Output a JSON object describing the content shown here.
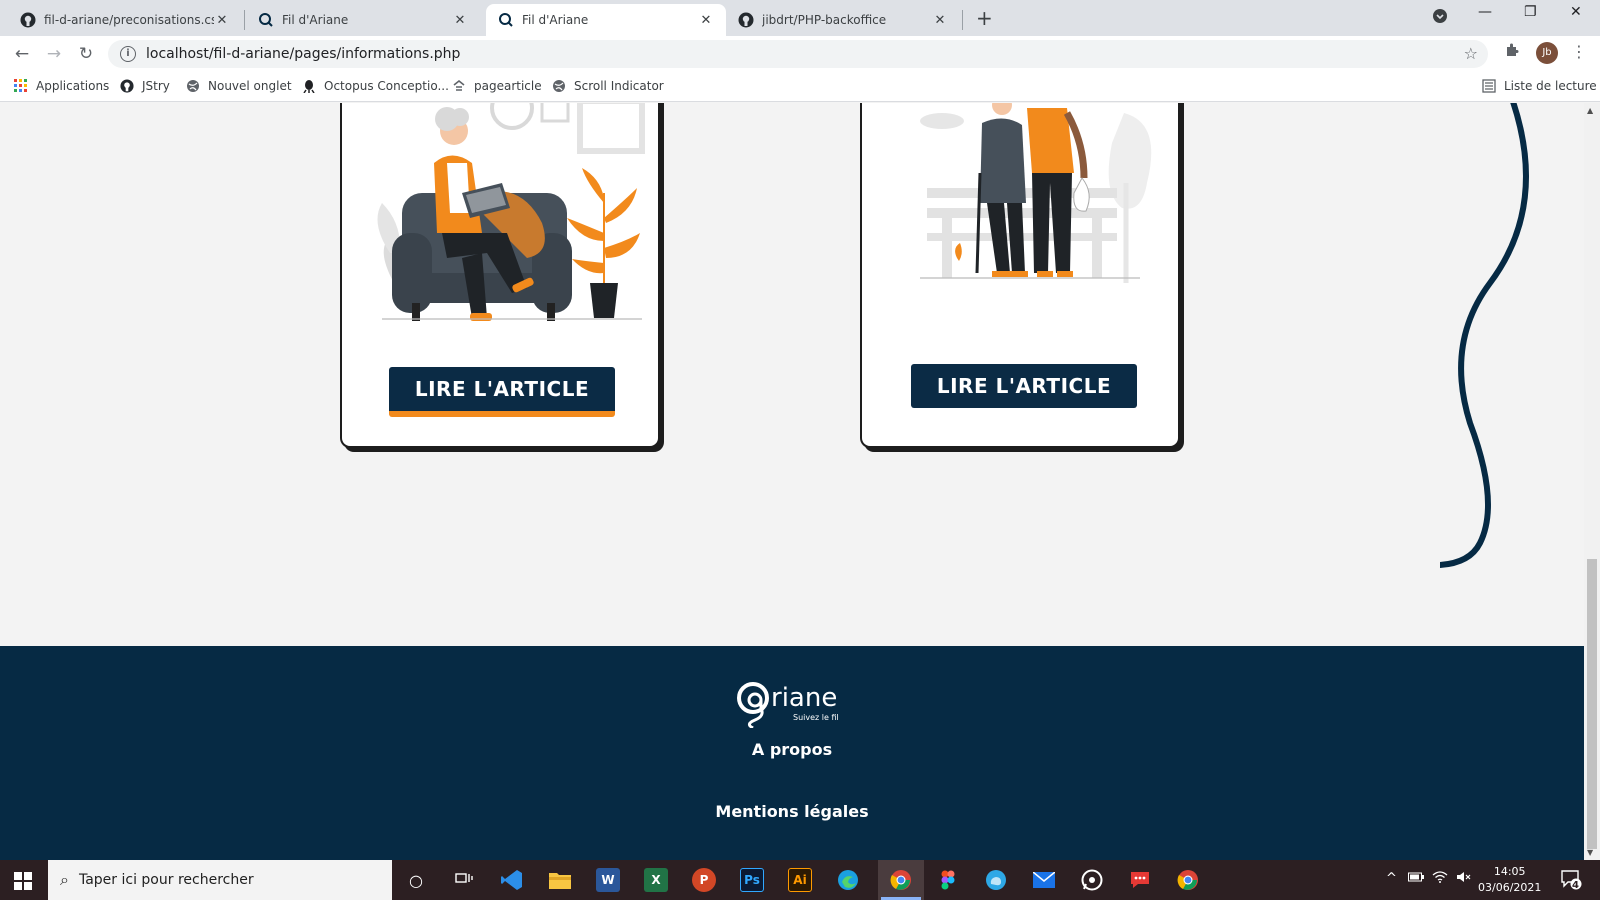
{
  "browser": {
    "tabs": [
      {
        "title": "fil-d-ariane/preconisations.css at",
        "icon": "github-icon"
      },
      {
        "title": "Fil d'Ariane",
        "icon": "ariane-icon"
      },
      {
        "title": "Fil d'Ariane",
        "icon": "ariane-icon",
        "active": true
      },
      {
        "title": "jibdrt/PHP-backoffice",
        "icon": "github-icon"
      }
    ],
    "url": "localhost/fil-d-ariane/pages/informations.php",
    "profile_initials": "Jb",
    "bookmarks": [
      {
        "label": "Applications",
        "icon": "apps-grid-icon"
      },
      {
        "label": "JStry",
        "icon": "github-icon"
      },
      {
        "label": "Nouvel onglet",
        "icon": "globe-icon"
      },
      {
        "label": "Octopus Conceptio...",
        "icon": "octopus-icon"
      },
      {
        "label": "pagearticle",
        "icon": "page-icon"
      },
      {
        "label": "Scroll Indicator",
        "icon": "globe-icon"
      }
    ],
    "reading_list": "Liste de lecture"
  },
  "page": {
    "cards": [
      {
        "button_label": "LIRE L'ARTICLE",
        "illustration": "woman-reading-armchair"
      },
      {
        "button_label": "LIRE L'ARTICLE",
        "illustration": "volunteer-helping-elder"
      }
    ],
    "footer": {
      "logo_word": "riane",
      "logo_tagline": "Suivez le fil",
      "links": [
        "A propos",
        "Mentions légales"
      ]
    },
    "colors": {
      "navy": "#062a44",
      "orange": "#f28a1c",
      "background": "#f3f3f3"
    }
  },
  "taskbar": {
    "search_placeholder": "Taper ici pour rechercher",
    "time": "14:05",
    "date": "03/06/2021",
    "notification_count": "4",
    "apps": [
      "task-view-icon",
      "vscode-icon",
      "file-explorer-icon",
      "word-icon",
      "excel-icon",
      "powerpoint-icon",
      "photoshop-icon",
      "illustrator-icon",
      "edge-icon",
      "chrome-icon",
      "figma-icon",
      "cloud-app-icon",
      "mail-icon",
      "whatsapp-icon",
      "chat-icon",
      "chrome-icon"
    ]
  }
}
